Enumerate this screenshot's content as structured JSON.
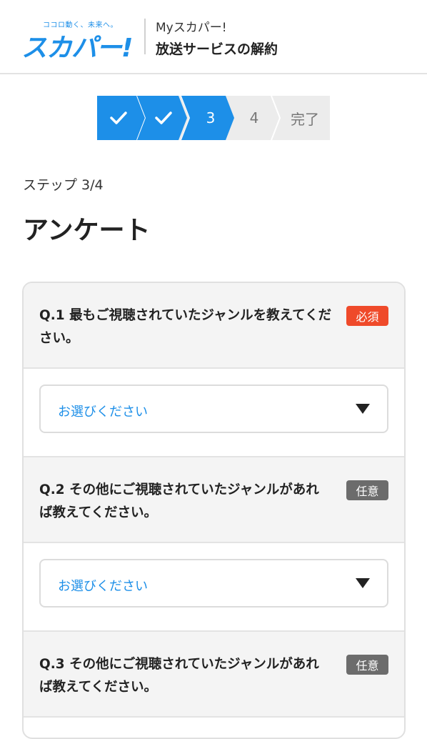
{
  "header": {
    "logo_tagline": "ココロ動く、未来へ。",
    "logo_text": "スカパー!",
    "sub_label": "Myスカパー!",
    "title": "放送サービスの解約"
  },
  "stepper": {
    "steps": [
      {
        "label": "",
        "state": "done"
      },
      {
        "label": "",
        "state": "done"
      },
      {
        "label": "3",
        "state": "current"
      },
      {
        "label": "4",
        "state": "pending"
      },
      {
        "label": "完了",
        "state": "pending"
      }
    ],
    "active_color": "#1d8fe8",
    "inactive_color": "#ececec"
  },
  "page": {
    "step_count": "ステップ 3/4",
    "title": "アンケート"
  },
  "questions": [
    {
      "text": "Q.1 最もご視聴されていたジャンルを教えてください。",
      "badge": "必須",
      "select_placeholder": "お選びください"
    },
    {
      "text": "Q.2 その他にご視聴されていたジャンルがあれば教えてください。",
      "badge": "任意",
      "select_placeholder": "お選びください"
    },
    {
      "text": "Q.3 その他にご視聴されていたジャンルがあれば教えてください。",
      "badge": "任意"
    }
  ],
  "colors": {
    "brand": "#1d8fe8",
    "required_badge": "#ef4a2a",
    "optional_badge": "#6c6c6c"
  }
}
